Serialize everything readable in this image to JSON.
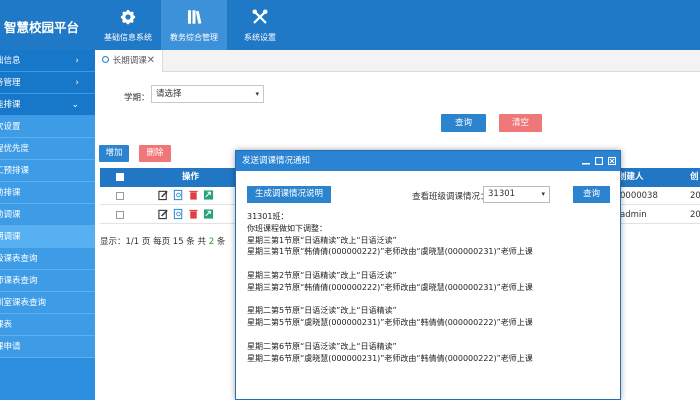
{
  "app": {
    "title": "智慧校园平台"
  },
  "topnav": [
    {
      "label": "基础信息系统",
      "icon": "gear-icon"
    },
    {
      "label": "教务综合管理",
      "icon": "books-icon"
    },
    {
      "label": "系统设置",
      "icon": "tools-icon"
    }
  ],
  "sidebar": {
    "items": [
      {
        "label": "础信息",
        "type": "head",
        "chevron": "›"
      },
      {
        "label": "务管理",
        "type": "head",
        "chevron": "›"
      },
      {
        "label": "能排课",
        "type": "head",
        "chevron": "⌄"
      },
      {
        "label": "次设置",
        "type": "sub"
      },
      {
        "label": "程优先度",
        "type": "sub"
      },
      {
        "label": "工预排课",
        "type": "sub"
      },
      {
        "label": "动排课",
        "type": "sub"
      },
      {
        "label": "动调课",
        "type": "sub"
      },
      {
        "label": "期调课",
        "type": "sub"
      },
      {
        "label": "级课表查询",
        "type": "sub"
      },
      {
        "label": "师课表查询",
        "type": "sub"
      },
      {
        "label": "训室课表查询",
        "type": "sub"
      },
      {
        "label": "课表",
        "type": "sub"
      },
      {
        "label": "课申请",
        "type": "sub"
      }
    ]
  },
  "tab": {
    "label": "长期调课",
    "close": "✕"
  },
  "filter": {
    "term_label": "学期：",
    "term_value": "请选择",
    "arrow": "▾",
    "query_label": "查询",
    "reset_label": "清空"
  },
  "toolbar": {
    "add_label": "增加",
    "delete_label": "删除"
  },
  "table": {
    "col_op": "操作",
    "col_creator": "创建人",
    "col_cr2": "创",
    "rows": [
      {
        "creator": "0000038",
        "cr2": "20"
      },
      {
        "creator": "admin",
        "cr2": "20"
      }
    ]
  },
  "pager": {
    "prefix": "显示：1/1 页 每页 15 条 共 ",
    "count": "2",
    "suffix": " 条"
  },
  "modal": {
    "title": "发送调课情况通知",
    "generate_label": "生成调课情况说明",
    "view_label": "查看班级调课情况：",
    "class_value": "31301",
    "arrow": "▾",
    "query_label": "查询",
    "lines": [
      "31301班：",
      "你班课程做如下调整：",
      "星期三第1节原“日语精读”改上“日语泛读”",
      "星期三第1节原“韩倩倩(000000222)”老师改由“虞晓慧(000000231)”老师上课",
      "",
      "星期三第2节原“日语精读”改上“日语泛读”",
      "星期三第2节原“韩倩倩(000000222)”老师改由“虞晓慧(000000231)”老师上课",
      "",
      "星期二第5节原“日语泛读”改上“日语精读”",
      "星期二第5节原“虞晓慧(000000231)”老师改由“韩倩倩(000000222)”老师上课",
      "",
      "星期二第6节原“日语泛读”改上“日语精读”",
      "星期二第6节原“虞晓慧(000000231)”老师改由“韩倩倩(000000222)”老师上课"
    ]
  },
  "colors": {
    "header": "#1f79c6",
    "sidebar": "#2c8fe0",
    "primary_button": "#2c84cf",
    "danger_button": "#f07777",
    "table_header": "#2277c4"
  }
}
